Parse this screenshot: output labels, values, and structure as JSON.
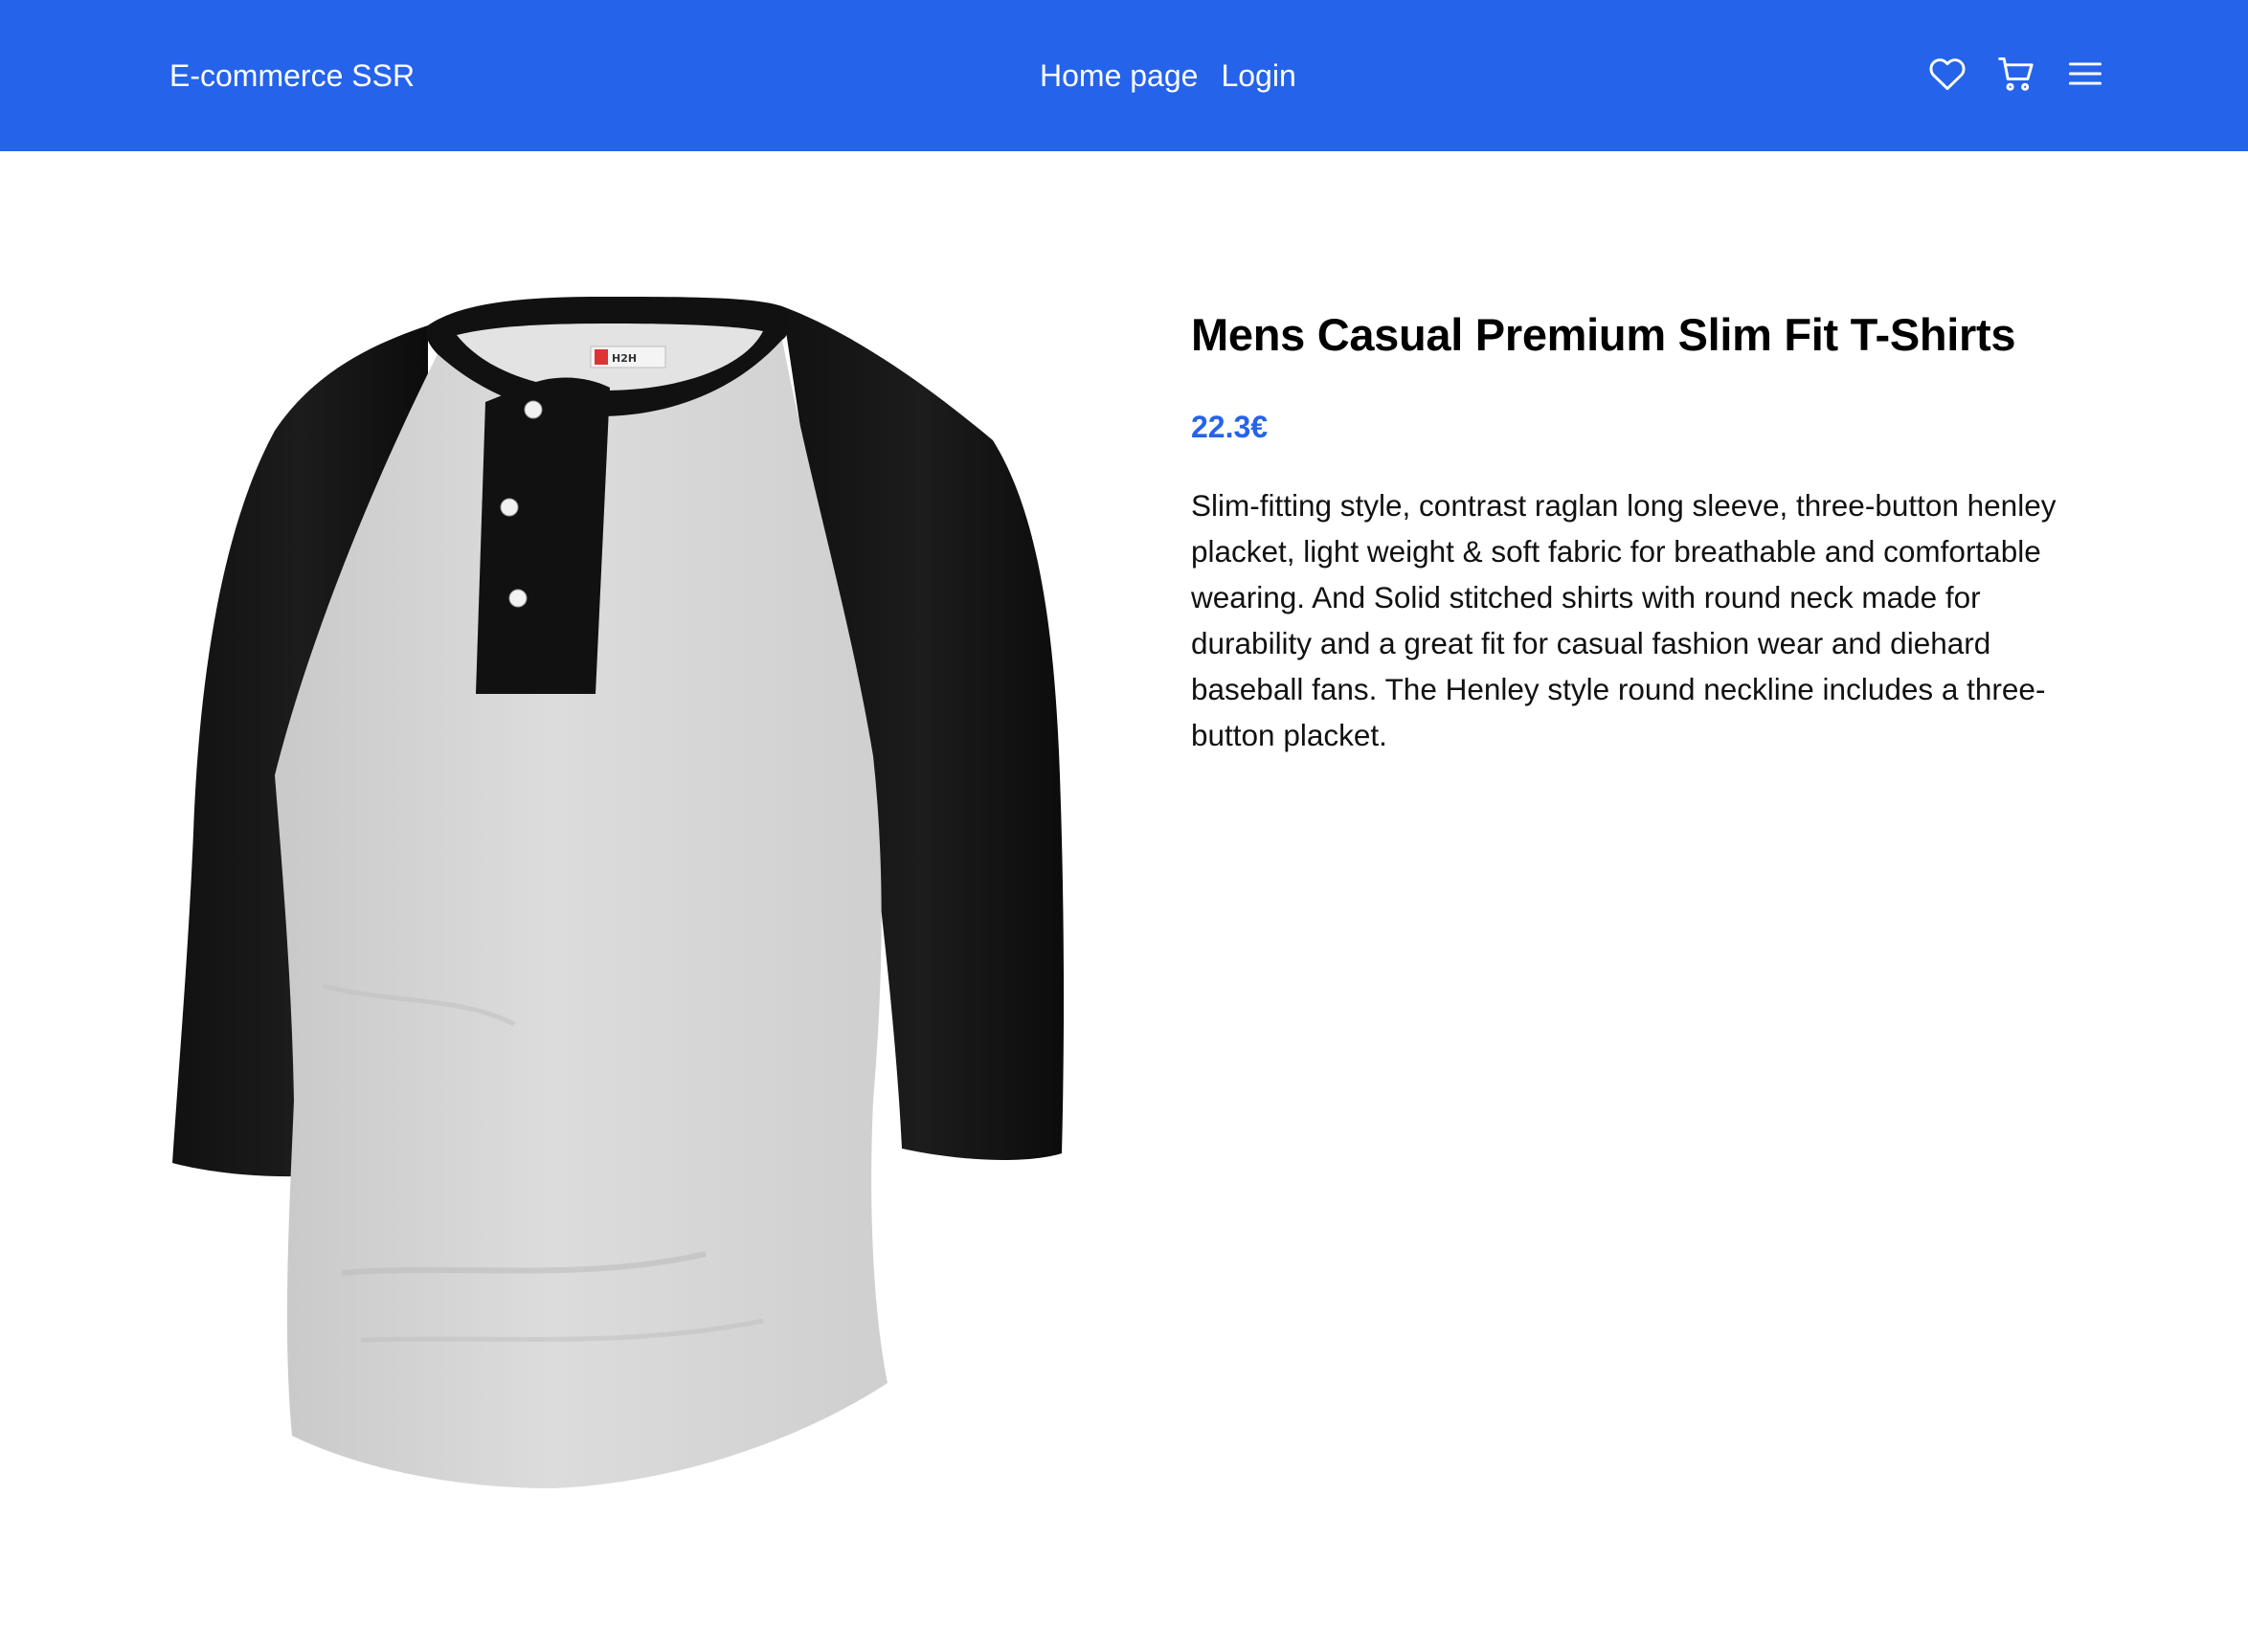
{
  "header": {
    "brand": "E-commerce SSR",
    "nav_links": [
      "Home page",
      "Login"
    ],
    "icons": [
      "heart-icon",
      "cart-icon",
      "menu-icon"
    ],
    "background_color": "#2563eb"
  },
  "product": {
    "title": "Mens Casual Premium Slim Fit T-Shirts",
    "price": "22.3€",
    "description": "Slim-fitting style, contrast raglan long sleeve, three-button henley placket, light weight & soft fabric for breathable and comfortable wearing. And Solid stitched shirts with round neck made for durability and a great fit for casual fashion wear and diehard baseball fans. The Henley style round neckline includes a three-button placket.",
    "image_label": "H2H",
    "price_color": "#2563eb"
  }
}
